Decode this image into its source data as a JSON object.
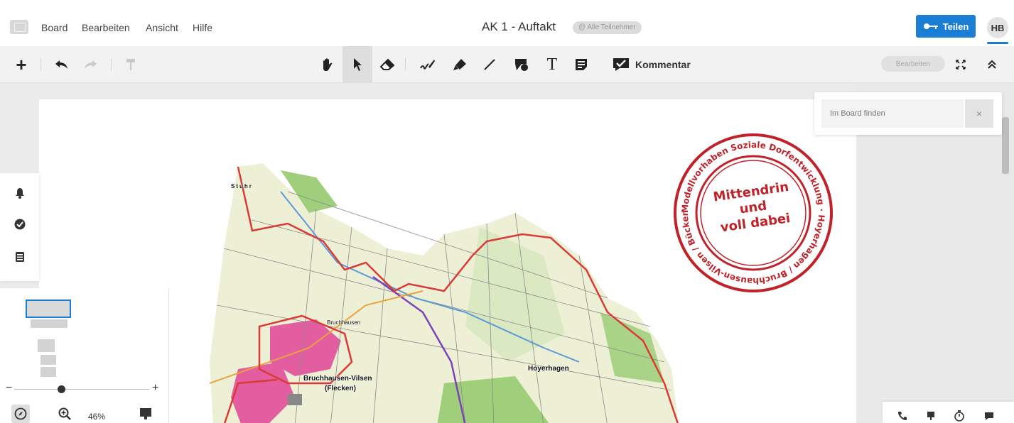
{
  "menubar": {
    "menus": [
      "Board",
      "Bearbeiten",
      "Ansicht",
      "Hilfe"
    ],
    "board_title": "AK 1 - Auftakt",
    "participants_badge": "@ Alle Teilnehmer",
    "share_label": "Teilen",
    "avatar_initials": "HB"
  },
  "toolbar": {
    "comment_label": "Kommentar",
    "edit_label": "Bearbeiten",
    "tools": [
      "add-icon",
      "undo-icon",
      "redo-icon",
      "format-painter-icon",
      "hand-icon",
      "pointer-icon",
      "eraser-icon",
      "pen-icon",
      "marker-icon",
      "line-icon",
      "shapes-icon",
      "text-icon",
      "sticky-note-icon",
      "comment-icon",
      "fullscreen-icon",
      "collapse-icon"
    ]
  },
  "search": {
    "placeholder": "Im Board finden",
    "close_glyph": "×"
  },
  "side_panel": {
    "icons": [
      "bell-icon",
      "check-circle-icon",
      "list-icon"
    ]
  },
  "navigator": {
    "zoom_level": "46%",
    "zoom_minus": "−",
    "zoom_plus": "+"
  },
  "canvas": {
    "map_labels": {
      "stuhr": "Stuhr",
      "bruchhausen": "Bruchhausen",
      "bruchhausen_vilsen": "Bruchhausen-Vilsen",
      "flecken": "(Flecken)",
      "hoyerhagen": "Hoyerhagen"
    },
    "stamp": {
      "ring_text": "Modellvorhaben Soziale Dorfentwicklung · Hoyerhagen / Bruchhausen-Vilsen / Bücken",
      "center_line1": "Mittendrin",
      "center_line2": "und",
      "center_line3": "voll dabei"
    }
  },
  "callbar": {
    "icons": [
      "phone-icon",
      "presentation-icon",
      "timer-icon",
      "chat-icon"
    ]
  },
  "colors": {
    "accent": "#1b7dd3",
    "stamp_red": "#c0222a",
    "map_border_red": "#d93a36",
    "map_purple": "#7b44b8",
    "map_green": "#7fbf5a"
  }
}
